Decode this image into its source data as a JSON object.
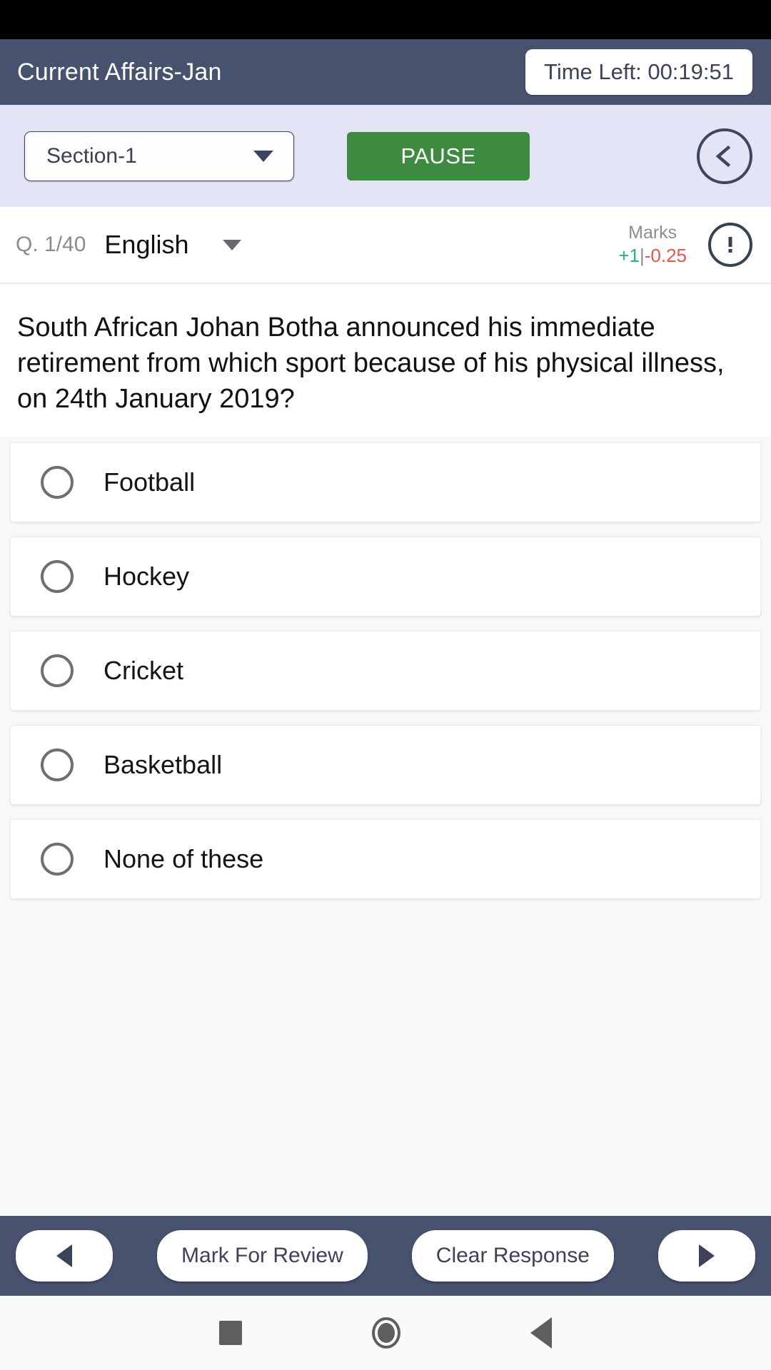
{
  "header": {
    "title": "Current Affairs-Jan",
    "timer_label": "Time Left: 00:19:51"
  },
  "section_bar": {
    "section_value": "Section-1",
    "pause_label": "PAUSE",
    "collapse_icon": "chevron-left-circle-icon"
  },
  "question_meta": {
    "q_index": "Q. 1/40",
    "language": "English",
    "marks_title": "Marks",
    "marks_positive": "+1",
    "marks_separator": "|",
    "marks_negative": "-0.25",
    "report_icon": "exclamation-circle-icon"
  },
  "question": {
    "text": "South African Johan Botha announced his immediate retirement from which sport because of his physical illness, on 24th January 2019?"
  },
  "options": [
    {
      "label": "Football",
      "selected": false
    },
    {
      "label": "Hockey",
      "selected": false
    },
    {
      "label": "Cricket",
      "selected": false
    },
    {
      "label": "Basketball",
      "selected": false
    },
    {
      "label": "None of these",
      "selected": false
    }
  ],
  "action_bar": {
    "prev_label": "◄",
    "mark_review_label": "Mark For Review",
    "clear_response_label": "Clear Response",
    "next_label": "►"
  },
  "nav_bar": {
    "recents_icon": "square-recents-icon",
    "home_icon": "circle-home-icon",
    "back_icon": "triangle-back-icon"
  },
  "colors": {
    "header_bg": "#47526f",
    "section_bg": "#e3e4f5",
    "pause_green": "#3d8b40",
    "marks_positive": "#27b489",
    "marks_negative": "#e05a4e",
    "page_bg": "#f8f8f8"
  }
}
